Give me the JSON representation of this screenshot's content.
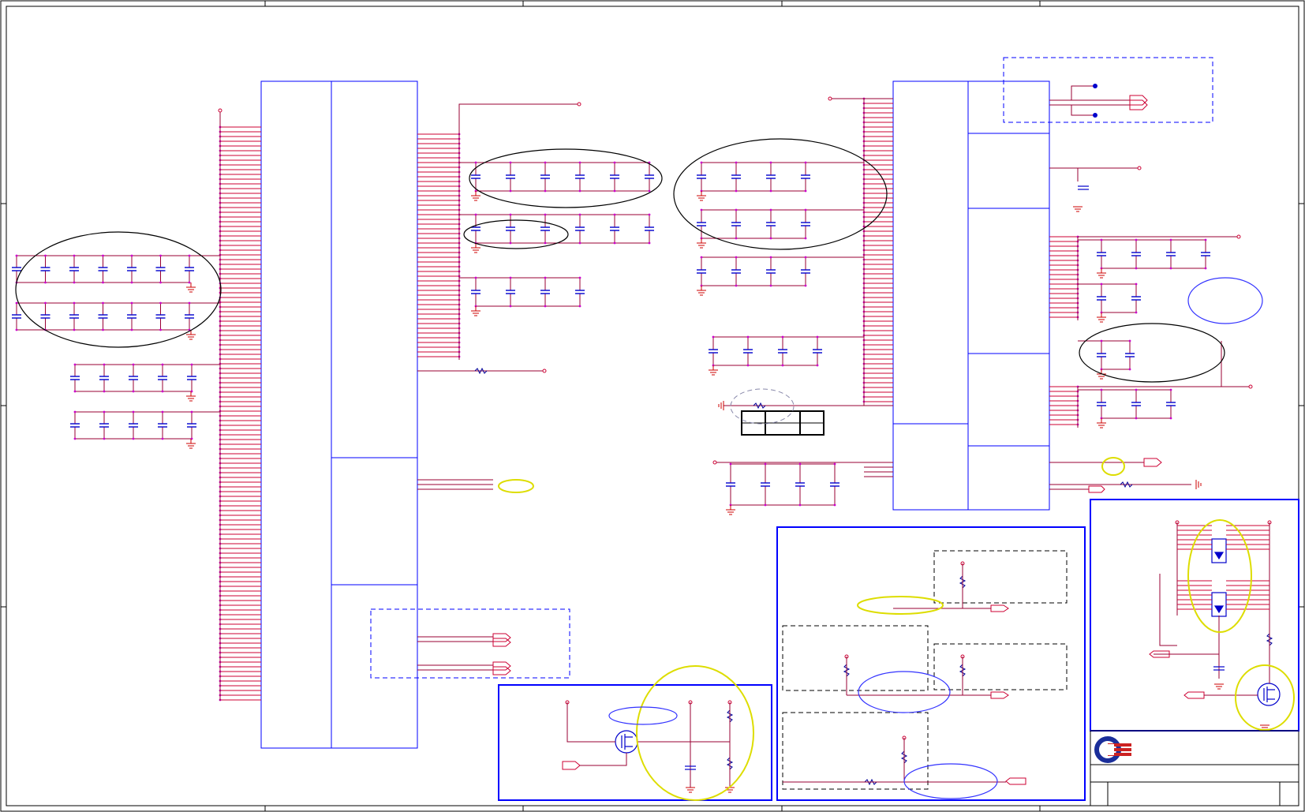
{
  "sheet": {
    "title": "",
    "background": "#ffffff"
  },
  "colors": {
    "frame": "#000000",
    "block": "#0000ff",
    "wire": "#990033",
    "pin": "#cc0033",
    "node": "#cc00cc",
    "component": "#0000cc",
    "ground": "#cc0000",
    "highlight_yellow": "#ffff00",
    "highlight_blue": "#3333ff",
    "highlight_black": "#000000"
  },
  "logo": {
    "name": "quanta-logo-icon"
  },
  "title_block": {
    "rows": [
      "",
      ""
    ]
  },
  "reference_table": {
    "cells": [
      "",
      "",
      ""
    ]
  }
}
